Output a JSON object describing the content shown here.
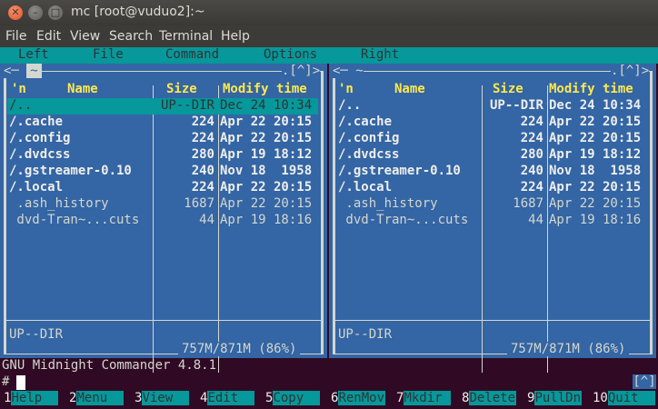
{
  "window": {
    "title": "mc [root@vuduo2]:~"
  },
  "menubar": [
    "File",
    "Edit",
    "View",
    "Search",
    "Terminal",
    "Help"
  ],
  "mc_menu": [
    "Left",
    "File",
    "Command",
    "Options",
    "Right"
  ],
  "left_panel": {
    "tilde": "~",
    "corner": ".[^]>",
    "headers": {
      "n": "'n",
      "name": "Name",
      "size": "Size",
      "time": "Modify time"
    },
    "rows": [
      {
        "name": "/..",
        "size": "UP--DIR",
        "date": "Dec 24 10:34",
        "sel": true,
        "bold": false
      },
      {
        "name": "/.cache",
        "size": "224",
        "date": "Apr 22 20:15",
        "bold": true
      },
      {
        "name": "/.config",
        "size": "224",
        "date": "Apr 22 20:15",
        "bold": true
      },
      {
        "name": "/.dvdcss",
        "size": "280",
        "date": "Apr 19 18:12",
        "bold": true
      },
      {
        "name": "/.gstreamer-0.10",
        "size": "240",
        "date": "Nov 18  1958",
        "bold": true
      },
      {
        "name": "/.local",
        "size": "224",
        "date": "Apr 22 20:15",
        "bold": true
      },
      {
        "name": " .ash_history",
        "size": "1687",
        "date": "Apr 22 20:15",
        "bold": false
      },
      {
        "name": " dvd-Tran~...cuts",
        "size": "44",
        "date": "Apr 19 18:16",
        "bold": false
      }
    ],
    "status": "UP--DIR",
    "footer": "757M/871M (86%)"
  },
  "right_panel": {
    "tilde": "~",
    "corner": ".[^]>",
    "headers": {
      "n": "'n",
      "name": "Name",
      "size": "Size",
      "time": "Modify time"
    },
    "rows": [
      {
        "name": "/..",
        "size": "UP--DIR",
        "date": "Dec 24 10:34",
        "bold": true
      },
      {
        "name": "/.cache",
        "size": "224",
        "date": "Apr 22 20:15",
        "bold": true
      },
      {
        "name": "/.config",
        "size": "224",
        "date": "Apr 22 20:15",
        "bold": true
      },
      {
        "name": "/.dvdcss",
        "size": "280",
        "date": "Apr 19 18:12",
        "bold": true
      },
      {
        "name": "/.gstreamer-0.10",
        "size": "240",
        "date": "Nov 18  1958",
        "bold": true
      },
      {
        "name": "/.local",
        "size": "224",
        "date": "Apr 22 20:15",
        "bold": true
      },
      {
        "name": " .ash_history",
        "size": "1687",
        "date": "Apr 22 20:15",
        "bold": false
      },
      {
        "name": " dvd-Tran~...cuts",
        "size": "44",
        "date": "Apr 19 18:16",
        "bold": false
      }
    ],
    "status": "UP--DIR",
    "footer": "757M/871M (86%)"
  },
  "version_line": "GNU Midnight Commander 4.8.1",
  "prompt": "#",
  "bracket": "[^]",
  "fkeys": [
    {
      "n": "1",
      "l": "Help"
    },
    {
      "n": "2",
      "l": "Menu"
    },
    {
      "n": "3",
      "l": "View"
    },
    {
      "n": "4",
      "l": "Edit"
    },
    {
      "n": "5",
      "l": "Copy"
    },
    {
      "n": "6",
      "l": "RenMov"
    },
    {
      "n": "7",
      "l": "Mkdir"
    },
    {
      "n": "8",
      "l": "Delete"
    },
    {
      "n": "9",
      "l": "PullDn"
    },
    {
      "n": "10",
      "l": "Quit"
    }
  ]
}
